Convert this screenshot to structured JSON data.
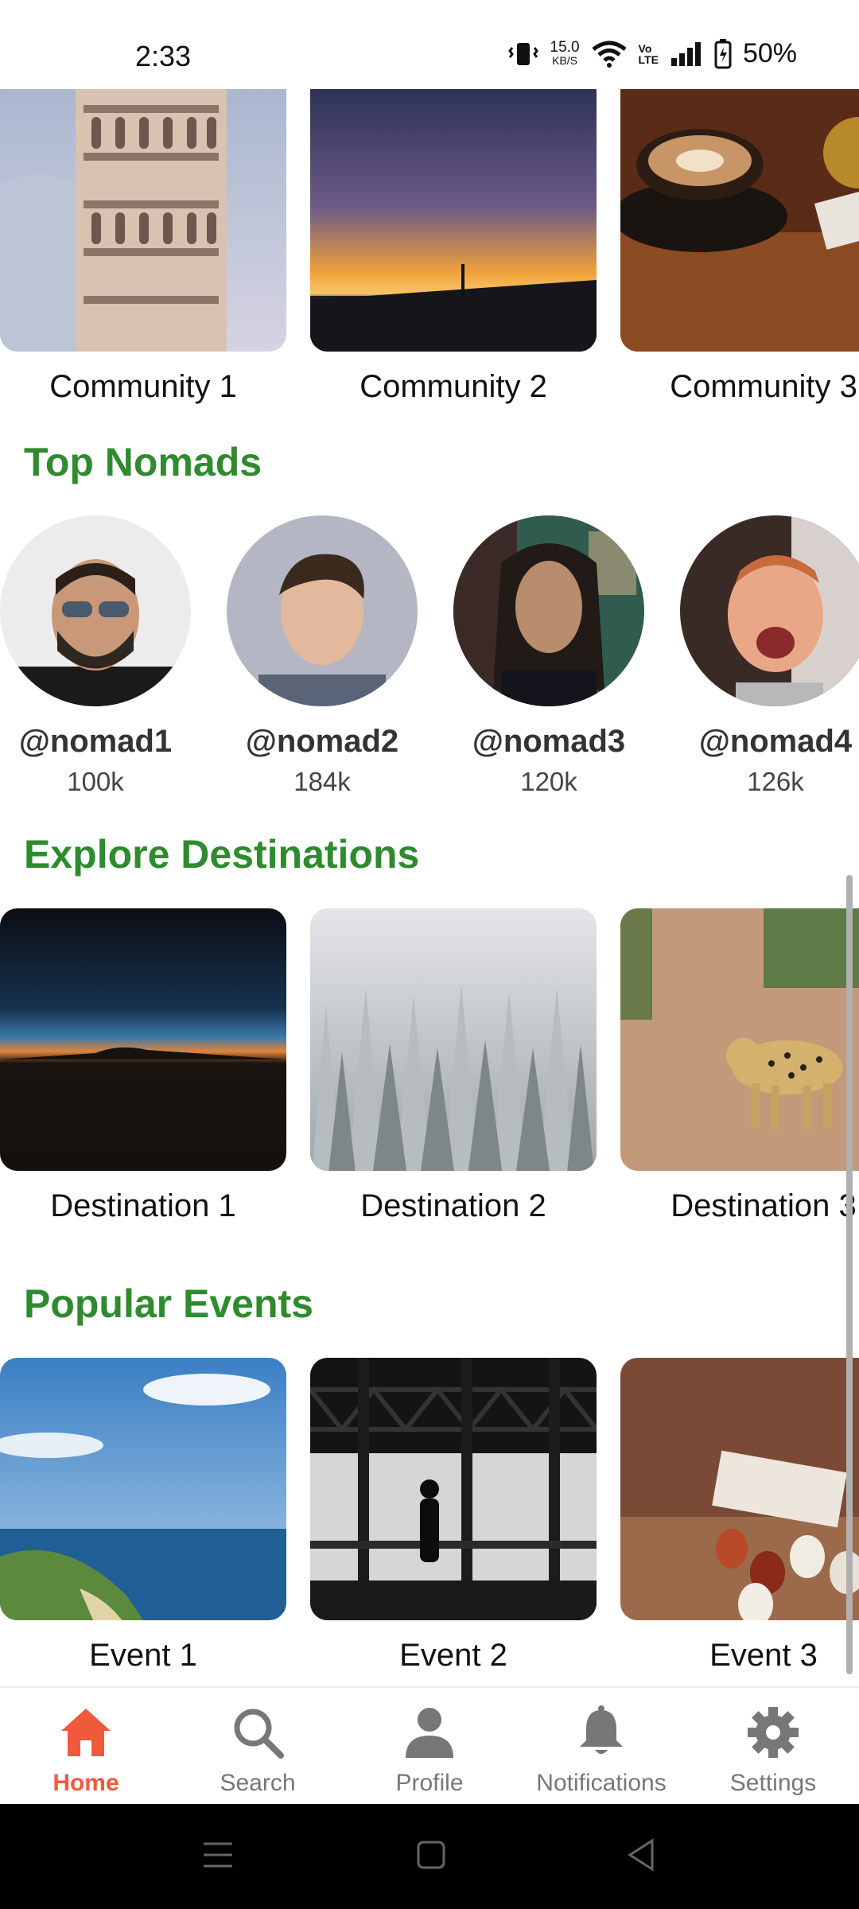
{
  "status_bar": {
    "time": "2:33",
    "net_speed_value": "15.0",
    "net_speed_unit": "KB/S",
    "volte_top": "Vo",
    "volte_bottom": "LTE",
    "battery": "50%"
  },
  "communities": [
    {
      "label": "Community 1",
      "image": "leaning-tower-photo"
    },
    {
      "label": "Community 2",
      "image": "pier-sunset-photo"
    },
    {
      "label": "Community 3",
      "image": "coffee-cup-photo"
    }
  ],
  "top_nomads": {
    "title": "Top Nomads",
    "items": [
      {
        "handle": "@nomad1",
        "followers": "100k"
      },
      {
        "handle": "@nomad2",
        "followers": "184k"
      },
      {
        "handle": "@nomad3",
        "followers": "120k"
      },
      {
        "handle": "@nomad4",
        "followers": "126k"
      }
    ]
  },
  "destinations": {
    "title": "Explore Destinations",
    "items": [
      {
        "label": "Destination 1",
        "image": "horizon-dusk-photo"
      },
      {
        "label": "Destination 2",
        "image": "snowy-forest-photo"
      },
      {
        "label": "Destination 3",
        "image": "leopard-road-photo"
      }
    ]
  },
  "events": {
    "title": "Popular Events",
    "items": [
      {
        "label": "Event 1",
        "image": "coastline-photo"
      },
      {
        "label": "Event 2",
        "image": "silhouette-hangar-photo"
      },
      {
        "label": "Event 3",
        "image": "tea-cups-photo"
      }
    ]
  },
  "bottom_nav": [
    {
      "label": "Home",
      "icon": "home-icon",
      "active": true
    },
    {
      "label": "Search",
      "icon": "search-icon",
      "active": false
    },
    {
      "label": "Profile",
      "icon": "person-icon",
      "active": false
    },
    {
      "label": "Notifications",
      "icon": "bell-icon",
      "active": false
    },
    {
      "label": "Settings",
      "icon": "gear-icon",
      "active": false
    }
  ],
  "colors": {
    "accent_green": "#2e8b2e",
    "active_nav": "#f05a3c",
    "inactive_nav": "#777777"
  }
}
